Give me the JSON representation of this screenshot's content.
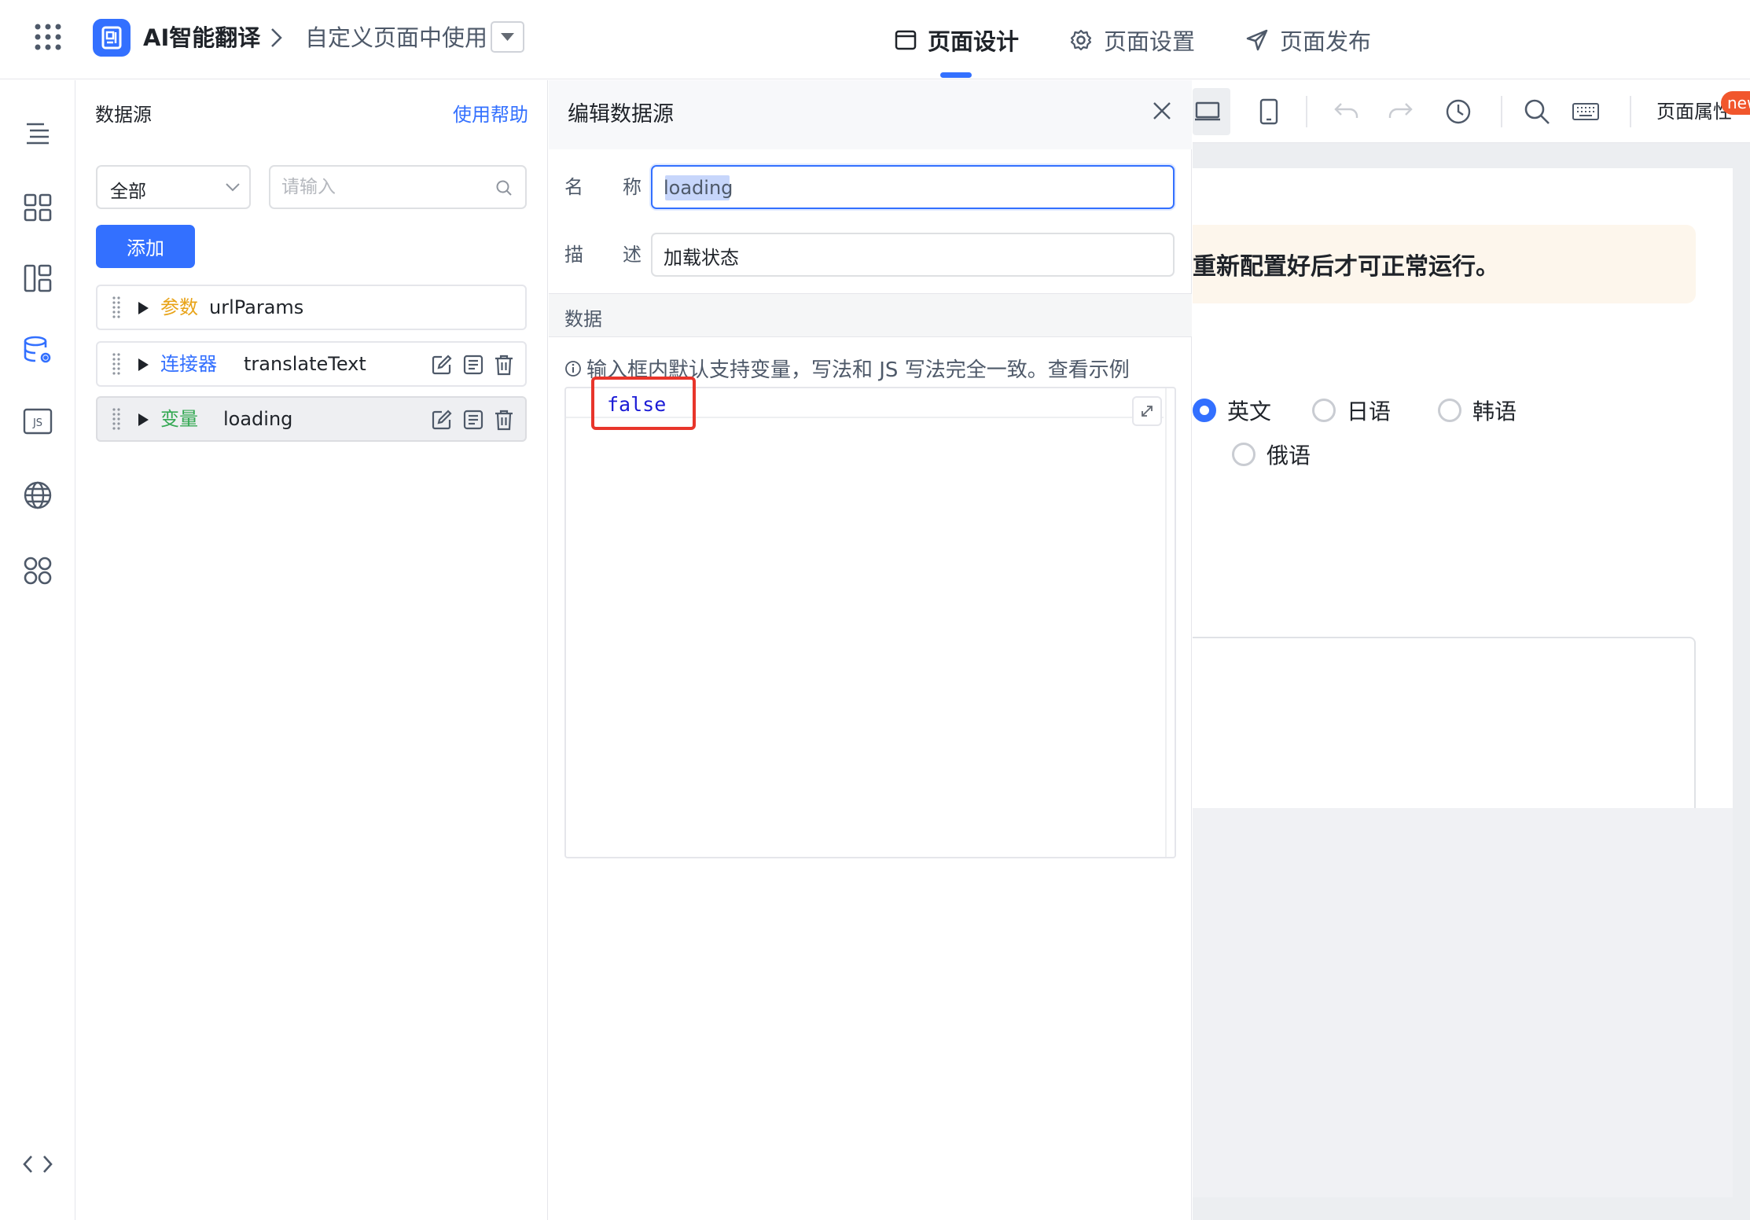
{
  "header": {
    "app_name": "AI智能翻译",
    "breadcrumb_page": "自定义页面中使用",
    "tabs": [
      {
        "label": "页面设计",
        "icon": "layout-icon",
        "active": true
      },
      {
        "label": "页面设置",
        "icon": "gear-icon",
        "active": false
      },
      {
        "label": "页面发布",
        "icon": "send-icon",
        "active": false
      }
    ],
    "accent_color": "#3370ff"
  },
  "rail": {
    "icons": [
      "outline-icon",
      "components-icon",
      "layout-blocks-icon",
      "datasource-icon",
      "js-icon",
      "globe-icon",
      "apps-icon"
    ],
    "bottom_icon": "code-icon"
  },
  "datasource": {
    "title": "数据源",
    "help_link": "使用帮助",
    "filter_value": "全部",
    "search_placeholder": "请输入",
    "add_label": "添加",
    "items": [
      {
        "tag": "参数",
        "tag_color": "#e8a317",
        "name": "urlParams",
        "selected": false,
        "actions": false
      },
      {
        "tag": "连接器",
        "tag_color": "#3370ff",
        "name": "translateText",
        "selected": false,
        "actions": true
      },
      {
        "tag": "变量",
        "tag_color": "#34a853",
        "name": "loading",
        "selected": true,
        "actions": true
      }
    ]
  },
  "editor": {
    "title": "编辑数据源",
    "name_label_1": "名",
    "name_label_2": "称",
    "name_value": "loading",
    "desc_label_1": "描",
    "desc_label_2": "述",
    "desc_value": "加载状态",
    "section_label": "数据",
    "hint": "输入框内默认支持变量，写法和 JS 写法完全一致。查看示例",
    "code_value": "false",
    "highlight_color": "#e8352b"
  },
  "canvas": {
    "page_props_label": "页面属性",
    "new_badge": "new",
    "warning_text": "重新配置好后才可正常运行。",
    "radio_options": [
      {
        "label": "英文",
        "checked": true
      },
      {
        "label": "日语",
        "checked": false
      },
      {
        "label": "韩语",
        "checked": false
      },
      {
        "label": "俄语",
        "checked": false
      }
    ]
  }
}
